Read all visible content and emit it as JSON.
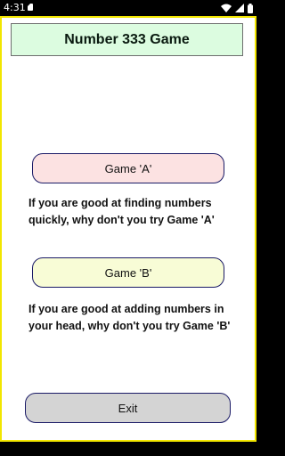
{
  "status_bar": {
    "time": "4:31",
    "icons": [
      "sd-card-icon",
      "wifi-icon",
      "signal-icon",
      "battery-icon"
    ]
  },
  "app": {
    "title": "Number 333 Game",
    "game_a": {
      "label": "Game  'A'",
      "description": "If you are good at finding numbers quickly, why don't you try Game 'A'"
    },
    "game_b": {
      "label": "Game  'B'",
      "description": "If you are good at adding numbers in your head, why don't you try Game 'B'"
    },
    "exit_label": "Exit"
  },
  "colors": {
    "title_bg": "#dcfce0",
    "game_a_bg": "#fce2e2",
    "game_b_bg": "#f8fcd6",
    "exit_bg": "#d4d4d4",
    "frame_border": "#f2e600",
    "button_border": "#1a1a66"
  }
}
